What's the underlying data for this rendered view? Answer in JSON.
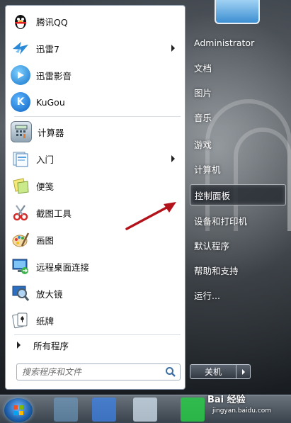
{
  "left_panel": {
    "items": [
      {
        "label": "腾讯QQ",
        "icon": "qq-penguin-icon",
        "has_submenu": false
      },
      {
        "label": "迅雷7",
        "icon": "thunder-bird-icon",
        "has_submenu": true
      },
      {
        "label": "迅雷影音",
        "icon": "thunder-player-icon",
        "has_submenu": false
      },
      {
        "label": "KuGou",
        "icon": "kugou-icon",
        "has_submenu": false
      },
      {
        "label": "计算器",
        "icon": "calculator-icon",
        "has_submenu": false
      },
      {
        "label": "入门",
        "icon": "getting-started-icon",
        "has_submenu": true
      },
      {
        "label": "便笺",
        "icon": "sticky-notes-icon",
        "has_submenu": false
      },
      {
        "label": "截图工具",
        "icon": "snipping-tool-icon",
        "has_submenu": false
      },
      {
        "label": "画图",
        "icon": "paint-icon",
        "has_submenu": false
      },
      {
        "label": "远程桌面连接",
        "icon": "remote-desktop-icon",
        "has_submenu": false
      },
      {
        "label": "放大镜",
        "icon": "magnifier-icon",
        "has_submenu": false
      },
      {
        "label": "纸牌",
        "icon": "solitaire-icon",
        "has_submenu": false
      }
    ],
    "all_programs": "所有程序",
    "search_placeholder": "搜索程序和文件"
  },
  "right_panel": {
    "items": [
      {
        "label": "Administrator",
        "highlighted": false
      },
      {
        "label": "文档",
        "highlighted": false
      },
      {
        "label": "图片",
        "highlighted": false
      },
      {
        "label": "音乐",
        "highlighted": false
      },
      {
        "label": "游戏",
        "highlighted": false
      },
      {
        "label": "计算机",
        "highlighted": false
      },
      {
        "label": "控制面板",
        "highlighted": true
      },
      {
        "label": "设备和打印机",
        "highlighted": false
      },
      {
        "label": "默认程序",
        "highlighted": false
      },
      {
        "label": "帮助和支持",
        "highlighted": false
      },
      {
        "label": "运行...",
        "highlighted": false
      }
    ],
    "shutdown_label": "关机"
  },
  "watermark": {
    "brand": "Bai 经验",
    "url": "jingyan.baidu.com"
  },
  "colors": {
    "highlight_border": "#e6ebf0",
    "annotation_arrow": "#b3121b"
  }
}
